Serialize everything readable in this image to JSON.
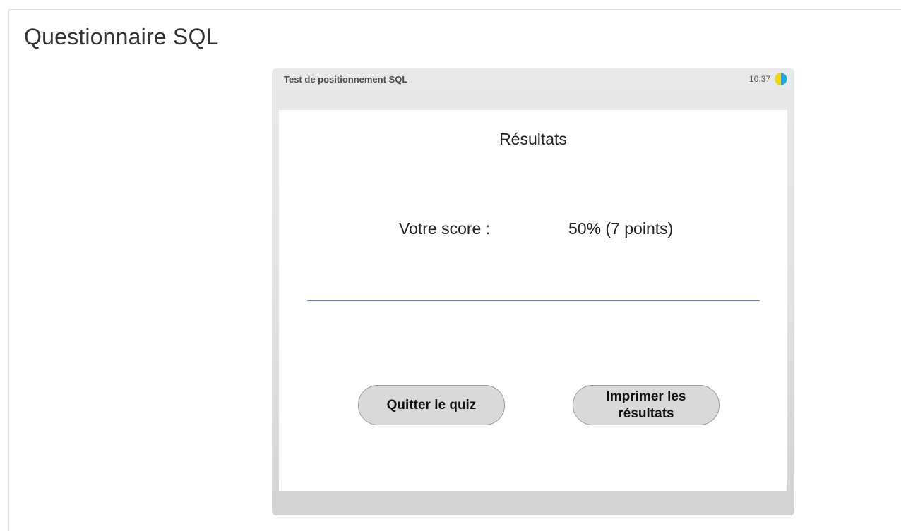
{
  "page": {
    "title": "Questionnaire SQL"
  },
  "player": {
    "title": "Test de positionnement SQL",
    "timer": "10:37",
    "timer_icon": "pie-timer-icon",
    "timer_colors": {
      "elapsed": "#f5d800",
      "remaining": "#1aa9e0"
    }
  },
  "slide": {
    "heading": "Résultats",
    "score_label": "Votre score :",
    "score_value": "50% (7 points)",
    "divider_color": "#4f81bd"
  },
  "buttons": {
    "quit_label": "Quitter le quiz",
    "print_label": "Imprimer les résultats"
  }
}
